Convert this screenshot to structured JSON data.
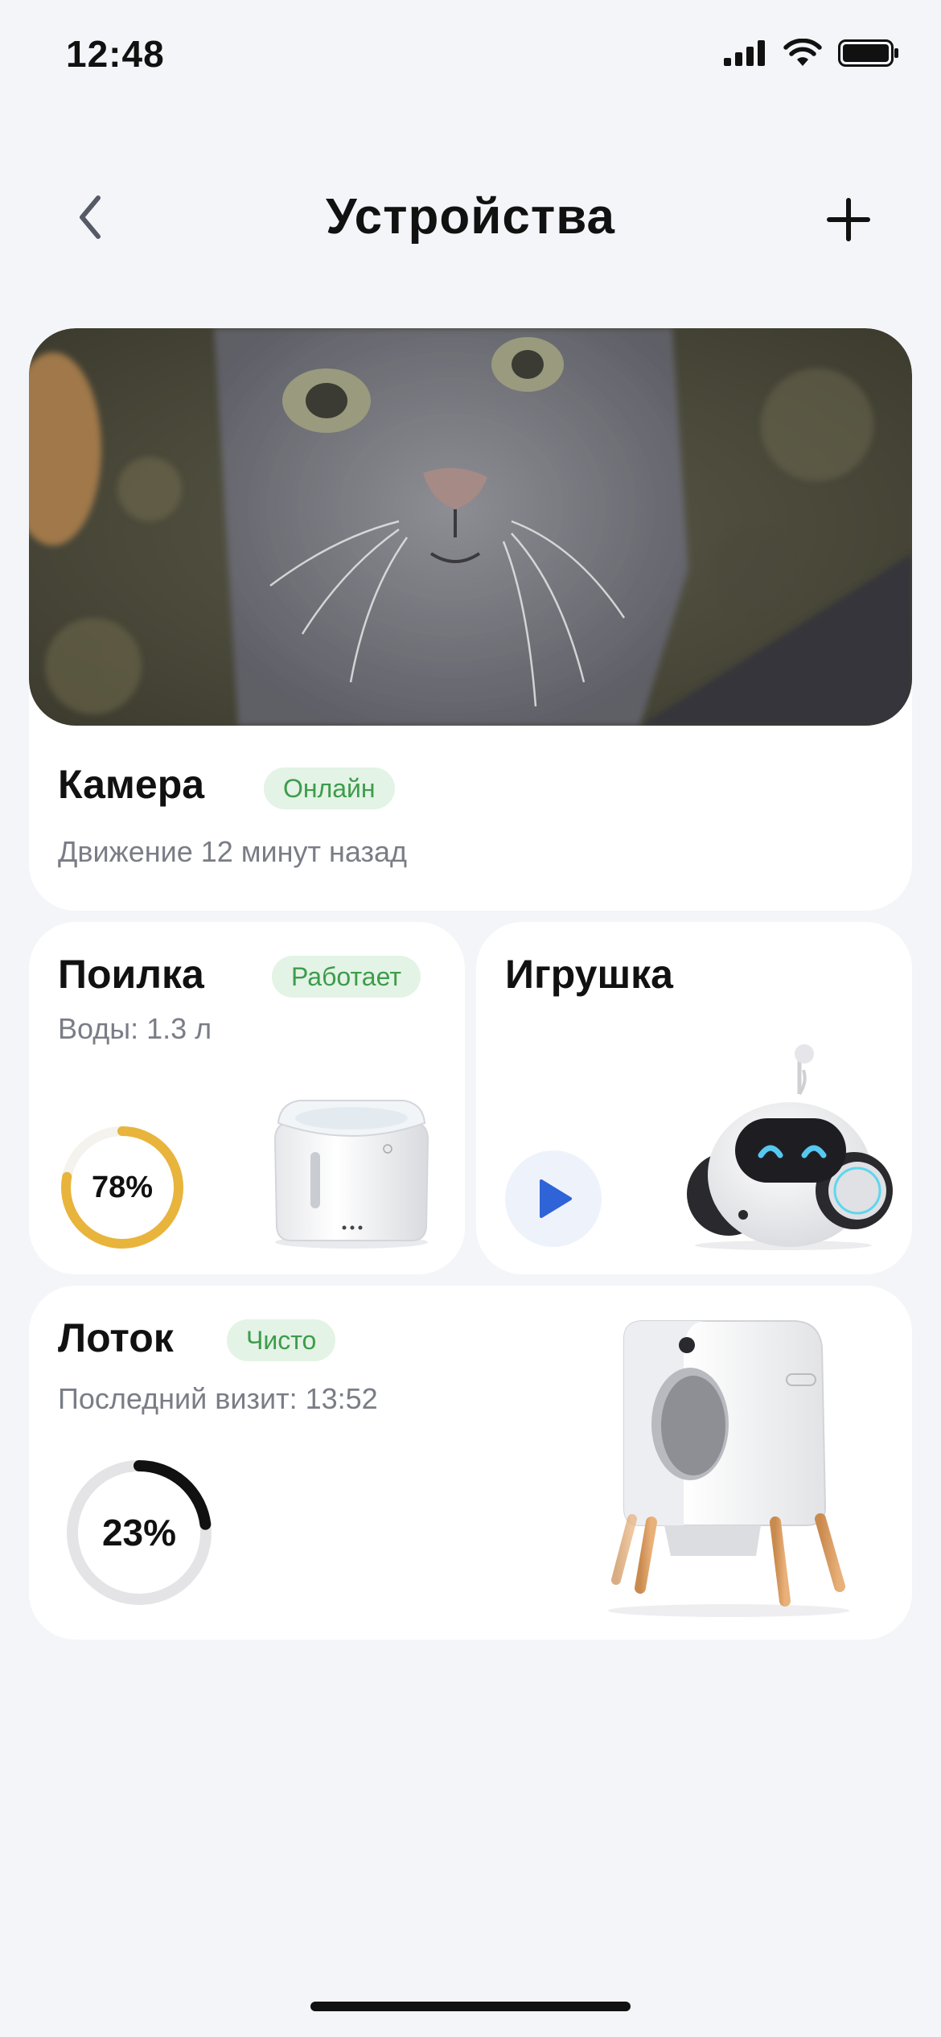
{
  "status_bar": {
    "time": "12:48"
  },
  "header": {
    "title": "Устройства",
    "back_icon": "chevron-left-icon",
    "add_icon": "plus-icon"
  },
  "camera": {
    "title": "Камера",
    "status": "Онлайн",
    "subtitle": "Движение 12 минут назад"
  },
  "feeder": {
    "title": "Поилка",
    "status": "Работает",
    "subtitle": "Воды: 1.3 л",
    "percent_label": "78%",
    "level": 0.78
  },
  "toy": {
    "title": "Игрушка",
    "play_icon": "play-icon"
  },
  "litter": {
    "title": "Лоток",
    "status": "Чисто",
    "subtitle": "Последний визит: 13:52",
    "percent_label": "23%",
    "level": 0.23
  },
  "colors": {
    "background": "#f4f5f9",
    "badge_bg": "#e3f3e5",
    "badge_text": "#3d9c4b",
    "feeder_ring": "#e8b43c",
    "litter_ring": "#111111",
    "play_accent": "#2f63d8"
  }
}
